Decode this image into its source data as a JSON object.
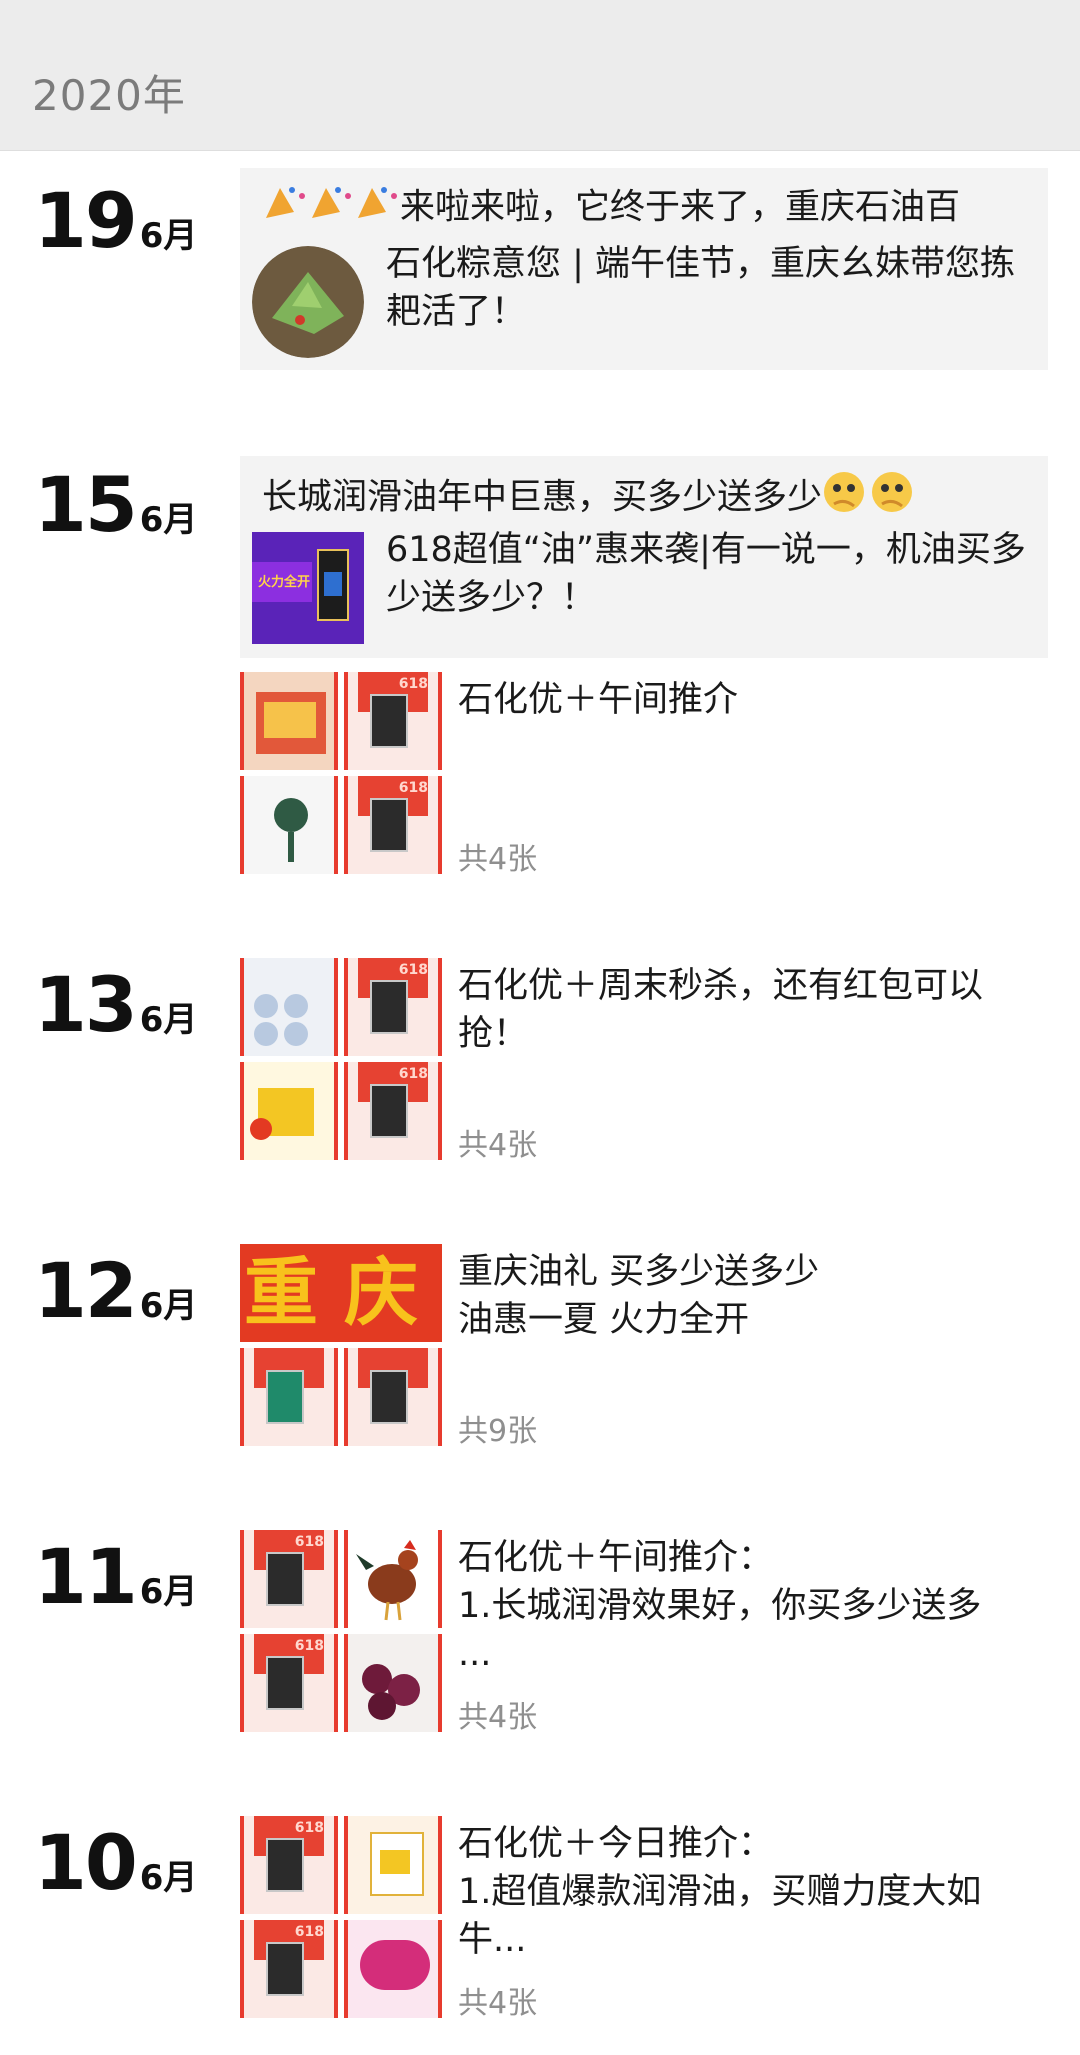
{
  "year": "2020年",
  "entries": [
    {
      "day": "19",
      "month": "6月",
      "title": "来啦来啦，它终于来了，重庆石油百",
      "subtitle": "石化粽意您 | 端午佳节，重庆幺妹带您拣耙活了！"
    },
    {
      "day": "15",
      "month": "6月",
      "title": "长城润滑油年中巨惠，买多少送多少",
      "subtitle": "618超值“油”惠来袭|有一说一，机油买多少送多少？！",
      "post_text": "石化优＋午间推介",
      "post_count": "共4张"
    },
    {
      "day": "13",
      "month": "6月",
      "post_text": "石化优＋周末秒杀，还有红包可以抢！",
      "post_count": "共4张"
    },
    {
      "day": "12",
      "month": "6月",
      "post_text_line1": "重庆油礼 买多少送多少",
      "post_text_line2": "油惠一夏 火力全开",
      "post_count": "共9张",
      "banner": [
        "重",
        "庆"
      ]
    },
    {
      "day": "11",
      "month": "6月",
      "post_text_line1": "石化优＋午间推介：",
      "post_text_line2": "1.长城润滑效果好，你买多少送多",
      "post_text_line3": "...",
      "post_count": "共4张"
    },
    {
      "day": "10",
      "month": "6月",
      "post_text_line1": "石化优＋今日推介：",
      "post_text_line2": "1.超值爆款润滑油，买赠力度大如",
      "post_text_line3": "牛...",
      "post_count": "共4张"
    }
  ],
  "tile_labels": {
    "n618": "618"
  },
  "colors": {
    "accent_red": "#e73b2e",
    "banner_yellow": "#f8c21c"
  }
}
